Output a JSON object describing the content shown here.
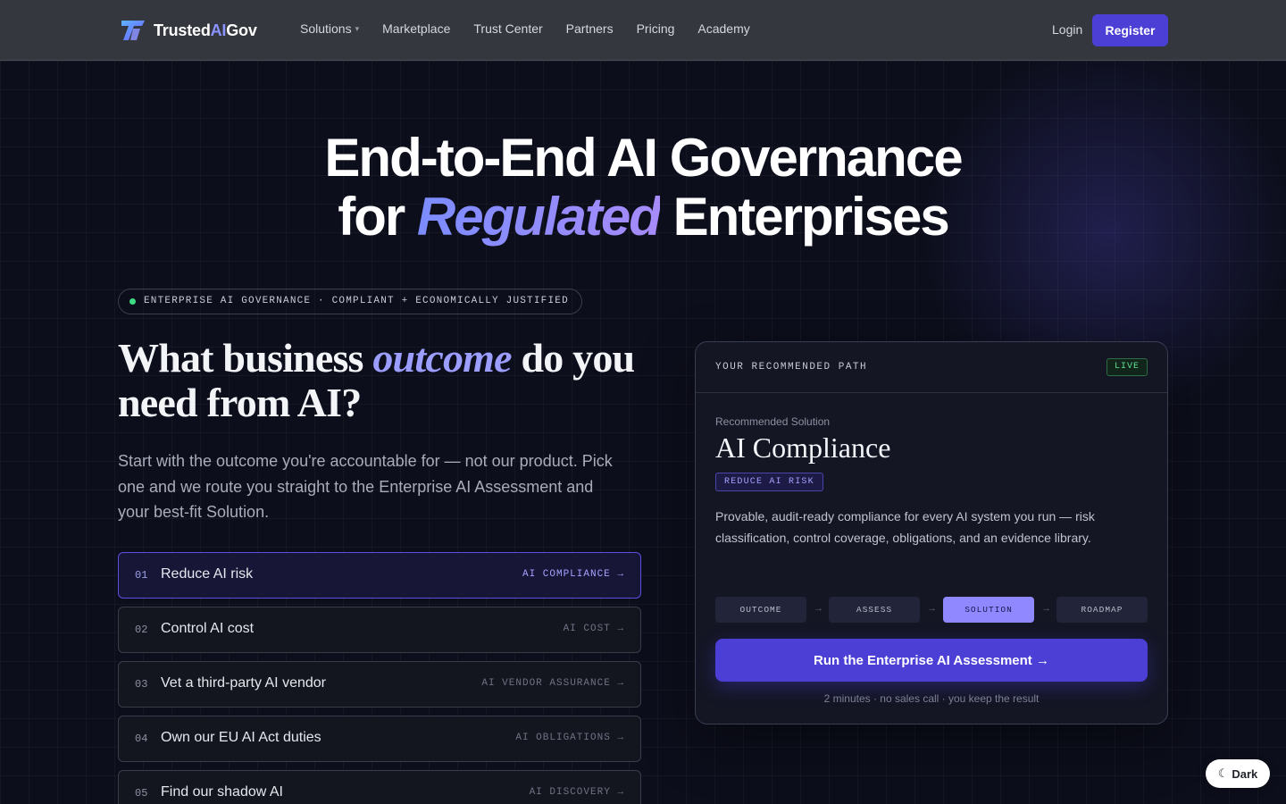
{
  "nav": {
    "brand_prefix": "Trusted",
    "brand_ai": "AI",
    "brand_suffix": "Gov",
    "links": [
      {
        "label": "Solutions",
        "has_caret": true
      },
      {
        "label": "Marketplace"
      },
      {
        "label": "Trust Center"
      },
      {
        "label": "Partners"
      },
      {
        "label": "Pricing"
      },
      {
        "label": "Academy"
      }
    ],
    "login": "Login",
    "register": "Register"
  },
  "hero": {
    "line1": "End-to-End AI Governance",
    "line2_pre": "for ",
    "line2_em": "Regulated",
    "line2_post": " Enterprises"
  },
  "tag_pill": "ENTERPRISE AI GOVERNANCE · COMPLIANT + ECONOMICALLY JUSTIFIED",
  "question": {
    "pre": "What business ",
    "em": "outcome",
    "post": " do you need from AI?"
  },
  "lead": "Start with the outcome you're accountable for — not our product. Pick one and we route you straight to the Enterprise AI Assessment and your best-fit Solution.",
  "options": [
    {
      "num": "01",
      "label": "Reduce AI risk",
      "tag": "AI COMPLIANCE →",
      "active": true
    },
    {
      "num": "02",
      "label": "Control AI cost",
      "tag": "AI COST →",
      "active": false
    },
    {
      "num": "03",
      "label": "Vet a third-party AI vendor",
      "tag": "AI VENDOR ASSURANCE →",
      "active": false
    },
    {
      "num": "04",
      "label": "Own our EU AI Act duties",
      "tag": "AI OBLIGATIONS →",
      "active": false
    },
    {
      "num": "05",
      "label": "Find our shadow AI",
      "tag": "AI DISCOVERY →",
      "active": false
    }
  ],
  "card": {
    "header": "YOUR RECOMMENDED PATH",
    "live": "LIVE",
    "rec_label": "Recommended Solution",
    "rec_title": "AI Compliance",
    "rec_chip": "REDUCE AI RISK",
    "rec_desc": "Provable, audit-ready compliance for every AI system you run — risk classification, control coverage, obligations, and an evidence library.",
    "steps": [
      "OUTCOME",
      "ASSESS",
      "SOLUTION",
      "ROADMAP"
    ],
    "active_step": "SOLUTION",
    "arrow": "→",
    "cta": "Run the Enterprise AI Assessment →",
    "cta_note": "2 minutes · no sales call · you keep the result"
  },
  "theme_toggle": {
    "icon": "moon-icon",
    "label": "Dark"
  },
  "colors": {
    "accent": "#4b3fd6",
    "accent_light": "#8f88ff",
    "live_green": "#5fe08f",
    "background": "#0c0e1b"
  }
}
